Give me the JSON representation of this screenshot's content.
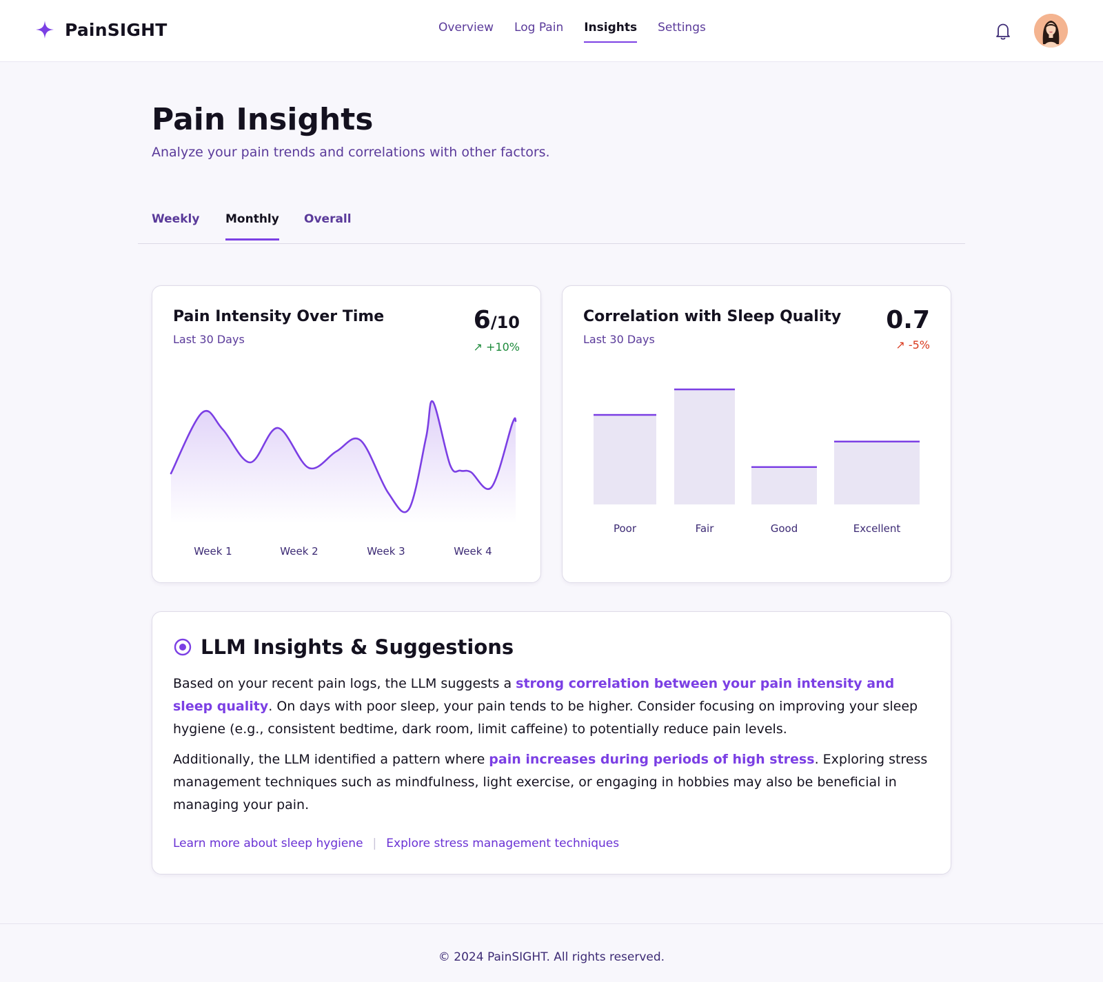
{
  "header": {
    "brand": "PainSIGHT",
    "nav": [
      {
        "label": "Overview",
        "active": false
      },
      {
        "label": "Log Pain",
        "active": false
      },
      {
        "label": "Insights",
        "active": true
      },
      {
        "label": "Settings",
        "active": false
      }
    ],
    "icons": {
      "brand": "sparkle-icon",
      "notifications": "bell-icon",
      "avatar": "user-avatar"
    }
  },
  "page": {
    "title": "Pain Insights",
    "subtitle": "Analyze your pain trends and correlations with other factors."
  },
  "tabs": [
    {
      "label": "Weekly",
      "active": false
    },
    {
      "label": "Monthly",
      "active": true
    },
    {
      "label": "Overall",
      "active": false
    }
  ],
  "pain_card": {
    "title": "Pain Intensity Over Time",
    "subtitle": "Last 30 Days",
    "metric_value": "6",
    "metric_denominator": "/10",
    "change": "+10%",
    "change_direction": "up",
    "change_color": "#1c8a3a"
  },
  "sleep_card": {
    "title": "Correlation with Sleep Quality",
    "subtitle": "Last 30 Days",
    "metric_value": "0.7",
    "change": "-5%",
    "change_direction": "up",
    "change_color": "#d93a1f"
  },
  "chart_data": [
    {
      "type": "area",
      "title": "Pain Intensity Over Time",
      "categories": [
        "Week 1",
        "Week 2",
        "Week 3",
        "Week 4"
      ],
      "x": [
        0,
        0.09,
        0.15,
        0.23,
        0.31,
        0.4,
        0.48,
        0.55,
        0.63,
        0.69,
        0.74,
        0.76,
        0.81,
        0.84,
        0.87,
        0.93,
        0.99,
        1.0
      ],
      "values": [
        4.4,
        8.8,
        7.6,
        5.2,
        7.7,
        4.8,
        6.0,
        6.8,
        3.0,
        1.8,
        7.0,
        9.6,
        5.0,
        4.6,
        4.5,
        3.4,
        8.0,
        8.2
      ],
      "ylim": [
        1,
        10
      ],
      "xlabel": "",
      "ylabel": "",
      "accent": "#7b3fe4"
    },
    {
      "type": "bar",
      "title": "Correlation with Sleep Quality",
      "categories": [
        "Poor",
        "Fair",
        "Good",
        "Excellent"
      ],
      "values": [
        7.8,
        10.0,
        3.3,
        5.5
      ],
      "ylim": [
        0,
        11
      ],
      "xlabel": "",
      "ylabel": "",
      "bar_fill": "#e9e5f4",
      "bar_top": "#7b3fe4"
    }
  ],
  "llm": {
    "title": "LLM Insights & Suggestions",
    "icon": "target-icon",
    "p1_a": "Based on your recent pain logs, the LLM suggests a ",
    "p1_hl": "strong correlation between your pain intensity and sleep quality",
    "p1_b": ". On days with poor sleep, your pain tends to be higher. Consider focusing on improving your sleep hygiene (e.g., consistent bedtime, dark room, limit caffeine) to potentially reduce pain levels.",
    "p2_a": "Additionally, the LLM identified a pattern where ",
    "p2_hl": "pain increases during periods of high stress",
    "p2_b": ". Exploring stress management techniques such as mindfulness, light exercise, or engaging in hobbies may also be beneficial in managing your pain.",
    "link1": "Learn more about sleep hygiene",
    "separator": "|",
    "link2": "Explore stress management techniques"
  },
  "footer": {
    "text": "© 2024 PainSIGHT. All rights reserved."
  }
}
